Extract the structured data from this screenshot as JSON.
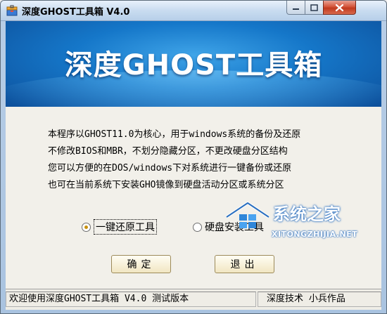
{
  "window": {
    "title": "深度GHOST工具箱 V4.0"
  },
  "banner": {
    "title": "深度GHOST工具箱"
  },
  "description": {
    "lines": [
      "本程序以GHOST11.0为核心，用于windows系统的备份及还原",
      "不修改BIOS和MBR，不划分隐藏分区，不更改硬盘分区结构",
      "您可以方便的在DOS/windows下对系统进行一键备份或还原",
      "也可在当前系统下安装GHO镜像到硬盘活动分区或系统分区"
    ]
  },
  "options": {
    "one_click_restore": {
      "label": "一键还原工具",
      "checked": true
    },
    "disk_install": {
      "label": "硬盘安装工具",
      "checked": false
    }
  },
  "buttons": {
    "ok": "确定",
    "exit": "退出"
  },
  "status": {
    "left": "欢迎使用深度GHOST工具箱 V4.0 测试版本",
    "right": "深度技术 小兵作品"
  },
  "watermark": {
    "title": "系统之家",
    "subtitle": "XITONGZHIJIA.NET"
  }
}
